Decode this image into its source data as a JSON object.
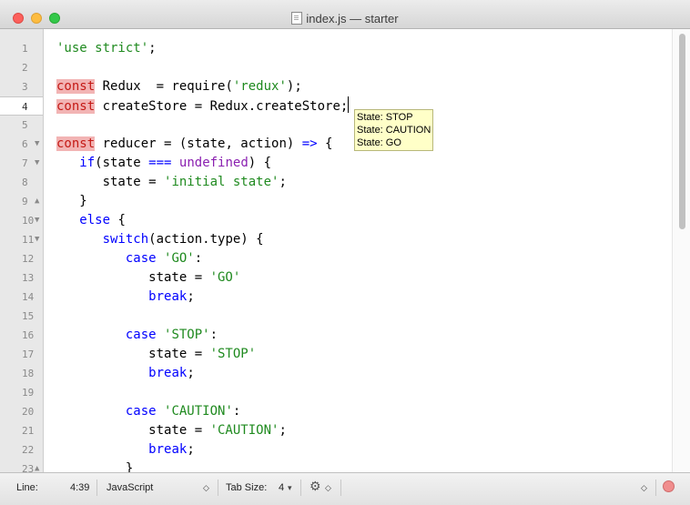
{
  "window": {
    "title": "index.js — starter"
  },
  "editor": {
    "line_numbers": [
      "1",
      "2",
      "3",
      "4",
      "5",
      "6",
      "7",
      "8",
      "9",
      "10",
      "11",
      "12",
      "13",
      "14",
      "15",
      "16",
      "17",
      "18",
      "19",
      "20",
      "21",
      "22",
      "23"
    ],
    "current_line": "4",
    "lines": [
      [
        [
          "str",
          "'use strict'"
        ],
        [
          "",
          "; "
        ]
      ],
      [],
      [
        [
          "hl",
          "const"
        ],
        [
          "",
          " Redux  = require("
        ],
        [
          "str",
          "'redux'"
        ],
        [
          "",
          ");"
        ]
      ],
      [
        [
          "hl",
          "const"
        ],
        [
          "",
          " createStore = Redux.createStore;"
        ],
        [
          "cursor",
          ""
        ]
      ],
      [],
      [
        [
          "hl",
          "const"
        ],
        [
          "",
          " reducer = (state, action) "
        ],
        [
          "kw",
          "=>"
        ],
        [
          "",
          " {"
        ]
      ],
      [
        [
          "",
          ""
        ],
        [
          "kw",
          "if"
        ],
        [
          "",
          "(state "
        ],
        [
          "kw",
          "==="
        ],
        [
          "",
          " "
        ],
        [
          "und",
          "undefined"
        ],
        [
          "",
          ") {"
        ]
      ],
      [
        [
          "",
          "      state = "
        ],
        [
          "str",
          "'initial state'"
        ],
        [
          "",
          ";"
        ]
      ],
      [
        [
          "",
          "   }"
        ]
      ],
      [
        [
          "",
          "   "
        ],
        [
          "kw",
          "else"
        ],
        [
          "",
          " {"
        ]
      ],
      [
        [
          "",
          "      "
        ],
        [
          "kw",
          "switch"
        ],
        [
          "",
          "(action.type) {"
        ]
      ],
      [
        [
          "",
          "         "
        ],
        [
          "kw",
          "case"
        ],
        [
          "",
          " "
        ],
        [
          "str",
          "'GO'"
        ],
        [
          "",
          ":"
        ]
      ],
      [
        [
          "",
          "            state = "
        ],
        [
          "str",
          "'GO'"
        ]
      ],
      [
        [
          "",
          "            "
        ],
        [
          "kw",
          "break"
        ],
        [
          "",
          ";"
        ]
      ],
      [],
      [
        [
          "",
          "         "
        ],
        [
          "kw",
          "case"
        ],
        [
          "",
          " "
        ],
        [
          "str",
          "'STOP'"
        ],
        [
          "",
          ":"
        ]
      ],
      [
        [
          "",
          "            state = "
        ],
        [
          "str",
          "'STOP'"
        ]
      ],
      [
        [
          "",
          "            "
        ],
        [
          "kw",
          "break"
        ],
        [
          "",
          ";"
        ]
      ],
      [],
      [
        [
          "",
          "         "
        ],
        [
          "kw",
          "case"
        ],
        [
          "",
          " "
        ],
        [
          "str",
          "'CAUTION'"
        ],
        [
          "",
          ":"
        ]
      ],
      [
        [
          "",
          "            state = "
        ],
        [
          "str",
          "'CAUTION'"
        ],
        [
          "",
          ";"
        ]
      ],
      [
        [
          "",
          "            "
        ],
        [
          "kw",
          "break"
        ],
        [
          "",
          ";"
        ]
      ],
      [
        [
          "",
          "         }"
        ]
      ]
    ],
    "folds": {
      "6": "▼",
      "7": "▼",
      "9": "▲",
      "10": "▼",
      "11": "▼",
      "23": "▲"
    },
    "tooltip": [
      "State: STOP",
      "State: CAUTION",
      "State: GO"
    ]
  },
  "statusbar": {
    "line_label": "Line:",
    "position": "4:39",
    "language": "JavaScript",
    "tab_size_label": "Tab Size:",
    "tab_size": "4"
  }
}
